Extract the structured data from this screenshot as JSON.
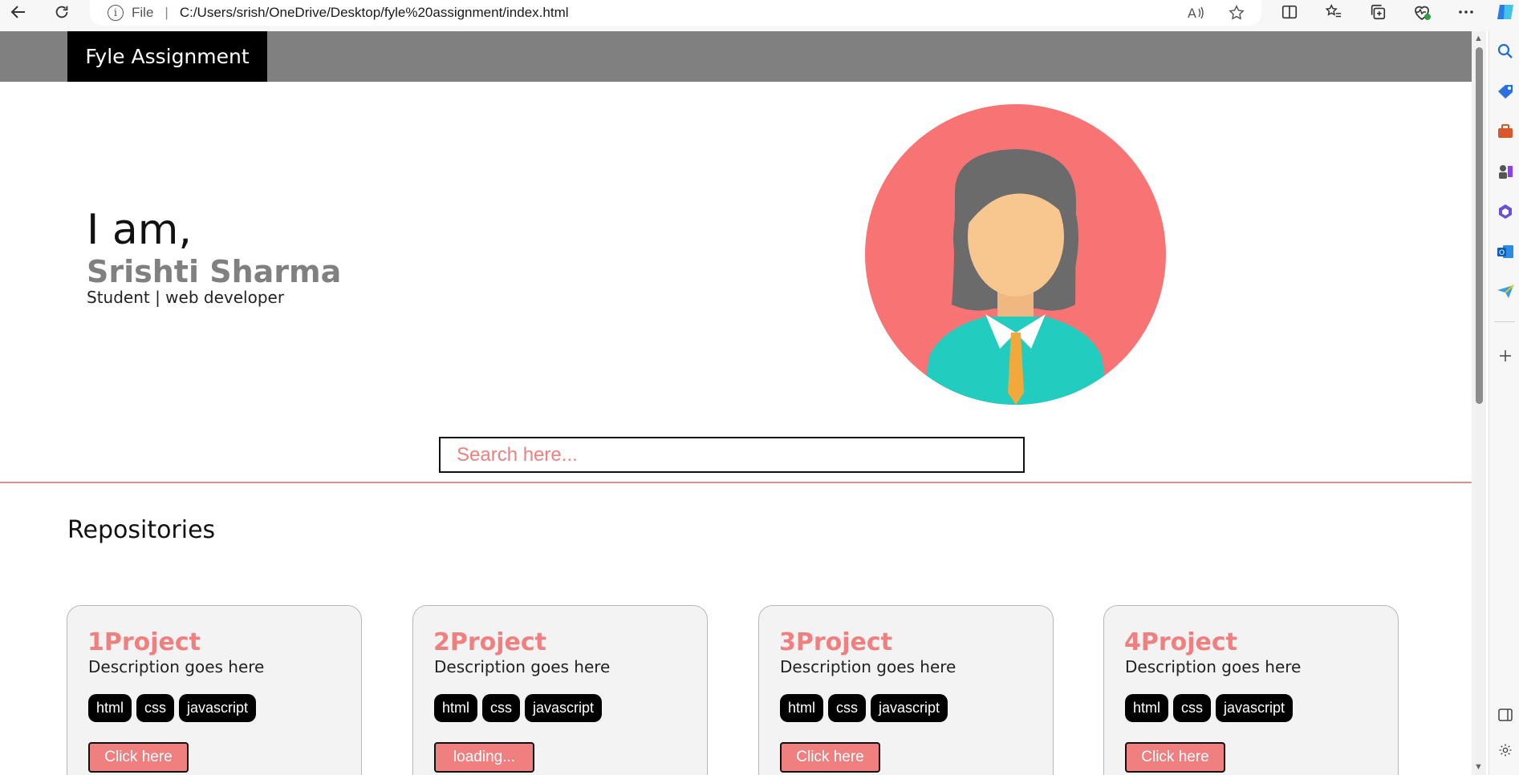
{
  "browser": {
    "file_label": "File",
    "separator": "|",
    "url": "C:/Users/srish/OneDrive/Desktop/fyle%20assignment/index.html"
  },
  "navbar": {
    "brand": "Fyle Assignment"
  },
  "hero": {
    "intro": "I am,",
    "name": "Srishti Sharma",
    "subtitle": "Student | web developer"
  },
  "search": {
    "placeholder": "Search here..."
  },
  "repositories": {
    "heading": "Repositories",
    "cards": [
      {
        "title": "1Project",
        "description": "Description goes here",
        "tags": [
          "html",
          "css",
          "javascript"
        ],
        "button": "Click here"
      },
      {
        "title": "2Project",
        "description": "Description goes here",
        "tags": [
          "html",
          "css",
          "javascript"
        ],
        "button": "loading..."
      },
      {
        "title": "3Project",
        "description": "Description goes here",
        "tags": [
          "html",
          "css",
          "javascript"
        ],
        "button": "Click here"
      },
      {
        "title": "4Project",
        "description": "Description goes here",
        "tags": [
          "html",
          "css",
          "javascript"
        ],
        "button": "Click here"
      }
    ]
  },
  "colors": {
    "accent": "#f08080",
    "navbar": "#808080",
    "brand_bg": "#000000",
    "avatar_circle": "#f87474",
    "shirt": "#22ccbf",
    "tie": "#f2a93b"
  }
}
